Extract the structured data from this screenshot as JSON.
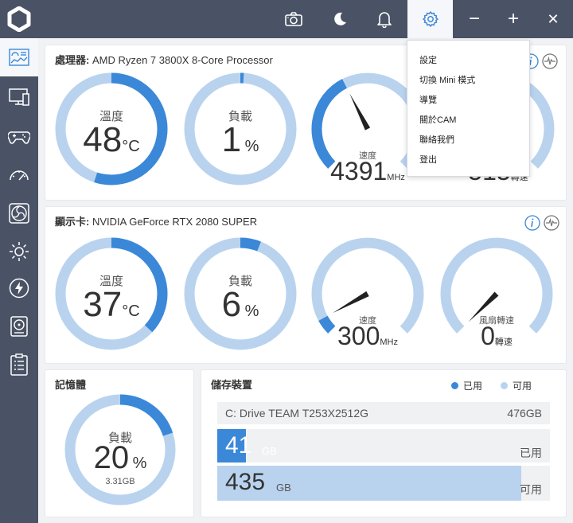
{
  "colors": {
    "chrome": "#4a5366",
    "accent": "#3b88d8",
    "light": "#b9d3ef"
  },
  "titlebar": {
    "icons": [
      "camera-icon",
      "moon-icon",
      "bell-icon",
      "gear-icon"
    ],
    "minimize": "−",
    "maximize": "+",
    "close": "✕"
  },
  "menu": {
    "items": [
      "設定",
      "切換 Mini 模式",
      "導覽",
      "關於CAM",
      "聯絡我們",
      "登出"
    ]
  },
  "cpu": {
    "prefix": "處理器:",
    "name": "AMD Ryzen 7 3800X 8-Core Processor",
    "temp": {
      "label": "溫度",
      "value": "48",
      "unit": "°C",
      "fraction": 0.55
    },
    "load": {
      "label": "負載",
      "value": "1",
      "unit": "%",
      "fraction": 0.01
    },
    "speed": {
      "label": "速度",
      "value": "4391",
      "unit": "MHz",
      "fraction": 0.4
    },
    "fan": {
      "value": "515",
      "unit": "轉速"
    }
  },
  "gpu": {
    "prefix": "顯示卡:",
    "name": "NVIDIA GeForce RTX 2080 SUPER",
    "temp": {
      "label": "溫度",
      "value": "37",
      "unit": "°C",
      "fraction": 0.37
    },
    "load": {
      "label": "負載",
      "value": "6",
      "unit": "%",
      "fraction": 0.06
    },
    "speed": {
      "label": "速度",
      "value": "300",
      "unit": "MHz",
      "fraction": 0.06
    },
    "fan": {
      "label": "風扇轉速",
      "value": "0",
      "unit": "轉速",
      "fraction": 0.0
    }
  },
  "memory": {
    "title": "記憶體",
    "label": "負載",
    "value": "20",
    "unit": "%",
    "detail": "3.31GB",
    "fraction": 0.2
  },
  "storage": {
    "title": "儲存裝置",
    "legend_used": "已用",
    "legend_free": "可用",
    "drive_name": "C: Drive TEAM T253X2512G",
    "drive_size": "476GB",
    "used_value": "41",
    "used_unit": "GB",
    "used_label": "已用",
    "free_value": "435",
    "free_unit": "GB",
    "free_label": "可用",
    "used_fraction": 0.086,
    "free_fraction": 0.914
  }
}
